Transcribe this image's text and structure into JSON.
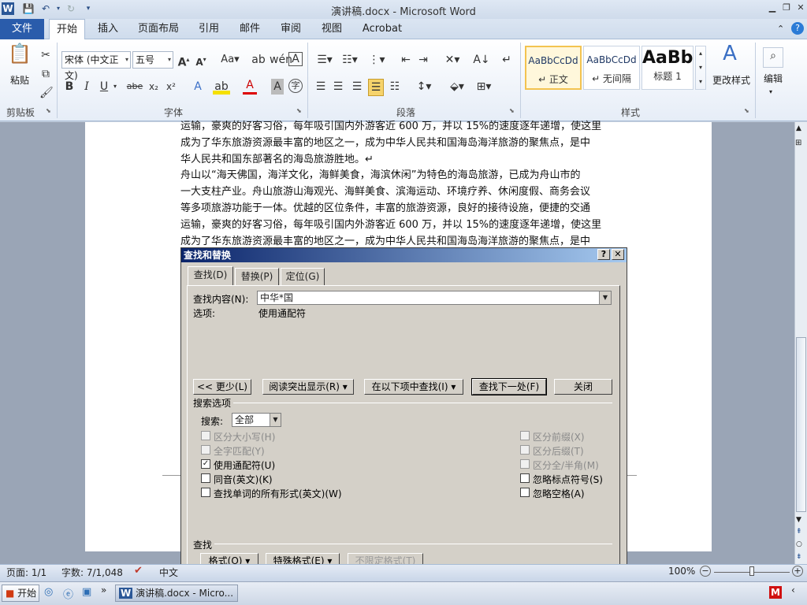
{
  "app": {
    "title": "演讲稿.docx - Microsoft Word",
    "word_icon": "W"
  },
  "menu": {
    "file_label": "文件",
    "tabs": [
      "开始",
      "插入",
      "页面布局",
      "引用",
      "邮件",
      "审阅",
      "视图",
      "Acrobat"
    ]
  },
  "ribbon": {
    "clipboard": {
      "paste_label": "粘贴",
      "group_label": "剪贴板"
    },
    "font": {
      "font_name": "宋体 (中文正文)",
      "font_size": "五号",
      "group_label": "字体"
    },
    "paragraph": {
      "group_label": "段落"
    },
    "styles": {
      "group_label": "样式",
      "items": [
        {
          "sample": "AaBbCcDd",
          "name": "↵ 正文"
        },
        {
          "sample": "AaBbCcDd",
          "name": "↵ 无间隔"
        },
        {
          "sample": "AaBb",
          "name": "标题 1"
        }
      ],
      "change_styles_label": "更改样式"
    },
    "editing": {
      "label": "编辑"
    }
  },
  "document": {
    "lines": [
      "运输，豪爽的好客习俗，每年吸引国内外游客近 600 万，并以 15%的速度逐年递增，使这里",
      "成为了华东旅游资源最丰富的地区之一，成为中华人民共和国海岛海洋旅游的聚焦点，是中",
      "华人民共和国东部著名的海岛旅游胜地。↵",
      "舟山以“海天佛国，海洋文化，海鲜美食，海滨休闲”为特色的海岛旅游，已成为舟山市的",
      "一大支柱产业。舟山旅游山海观光、海鲜美食、滨海运动、环境疗养、休闲度假、商务会议",
      "等多项旅游功能于一体。优越的区位条件，丰富的旅游资源，良好的接待设施，便捷的交通",
      "运输，豪爽的好客习俗，每年吸引国内外游客近 600 万，并以 15%的速度逐年递增，使这里",
      "成为了华东旅游资源最丰富的地区之一，成为中华人民共和国海岛海洋旅游的聚焦点，是中"
    ]
  },
  "dialog": {
    "title": "查找和替换",
    "help_btn": "?",
    "close_btn": "✕",
    "tabs": [
      "查找(D)",
      "替换(P)",
      "定位(G)"
    ],
    "find_label": "查找内容(N):",
    "find_value": "中华*国",
    "options_label": "选项:",
    "options_value": "使用通配符",
    "buttons": {
      "less": "<< 更少(L)",
      "reading_highlight": "阅读突出显示(R) ▾",
      "find_in": "在以下项中查找(I) ▾",
      "find_next": "查找下一处(F)",
      "close": "关闭"
    },
    "search_options_label": "搜索选项",
    "search_label": "搜索:",
    "search_value": "全部",
    "checkboxes_left": [
      {
        "label": "区分大小写(H)",
        "checked": false,
        "disabled": true
      },
      {
        "label": "全字匹配(Y)",
        "checked": false,
        "disabled": true
      },
      {
        "label": "使用通配符(U)",
        "checked": true,
        "disabled": false
      },
      {
        "label": "同音(英文)(K)",
        "checked": false,
        "disabled": false
      },
      {
        "label": "查找单词的所有形式(英文)(W)",
        "checked": false,
        "disabled": false
      }
    ],
    "checkboxes_right": [
      {
        "label": "区分前缀(X)",
        "checked": false,
        "disabled": true
      },
      {
        "label": "区分后缀(T)",
        "checked": false,
        "disabled": true
      },
      {
        "label": "区分全/半角(M)",
        "checked": false,
        "disabled": true
      },
      {
        "label": "忽略标点符号(S)",
        "checked": false,
        "disabled": false
      },
      {
        "label": "忽略空格(A)",
        "checked": false,
        "disabled": false
      }
    ],
    "find_section_label": "查找",
    "format_btn": "格式(O) ▾",
    "special_btn": "特殊格式(E) ▾",
    "no_format_btn": "不限定格式(T)"
  },
  "status": {
    "page": "页面: 1/1",
    "words": "字数: 7/1,048",
    "lang": "中文",
    "zoom": "100%"
  },
  "taskbar": {
    "start_label": "开始",
    "task_label": "演讲稿.docx - Micro..."
  }
}
